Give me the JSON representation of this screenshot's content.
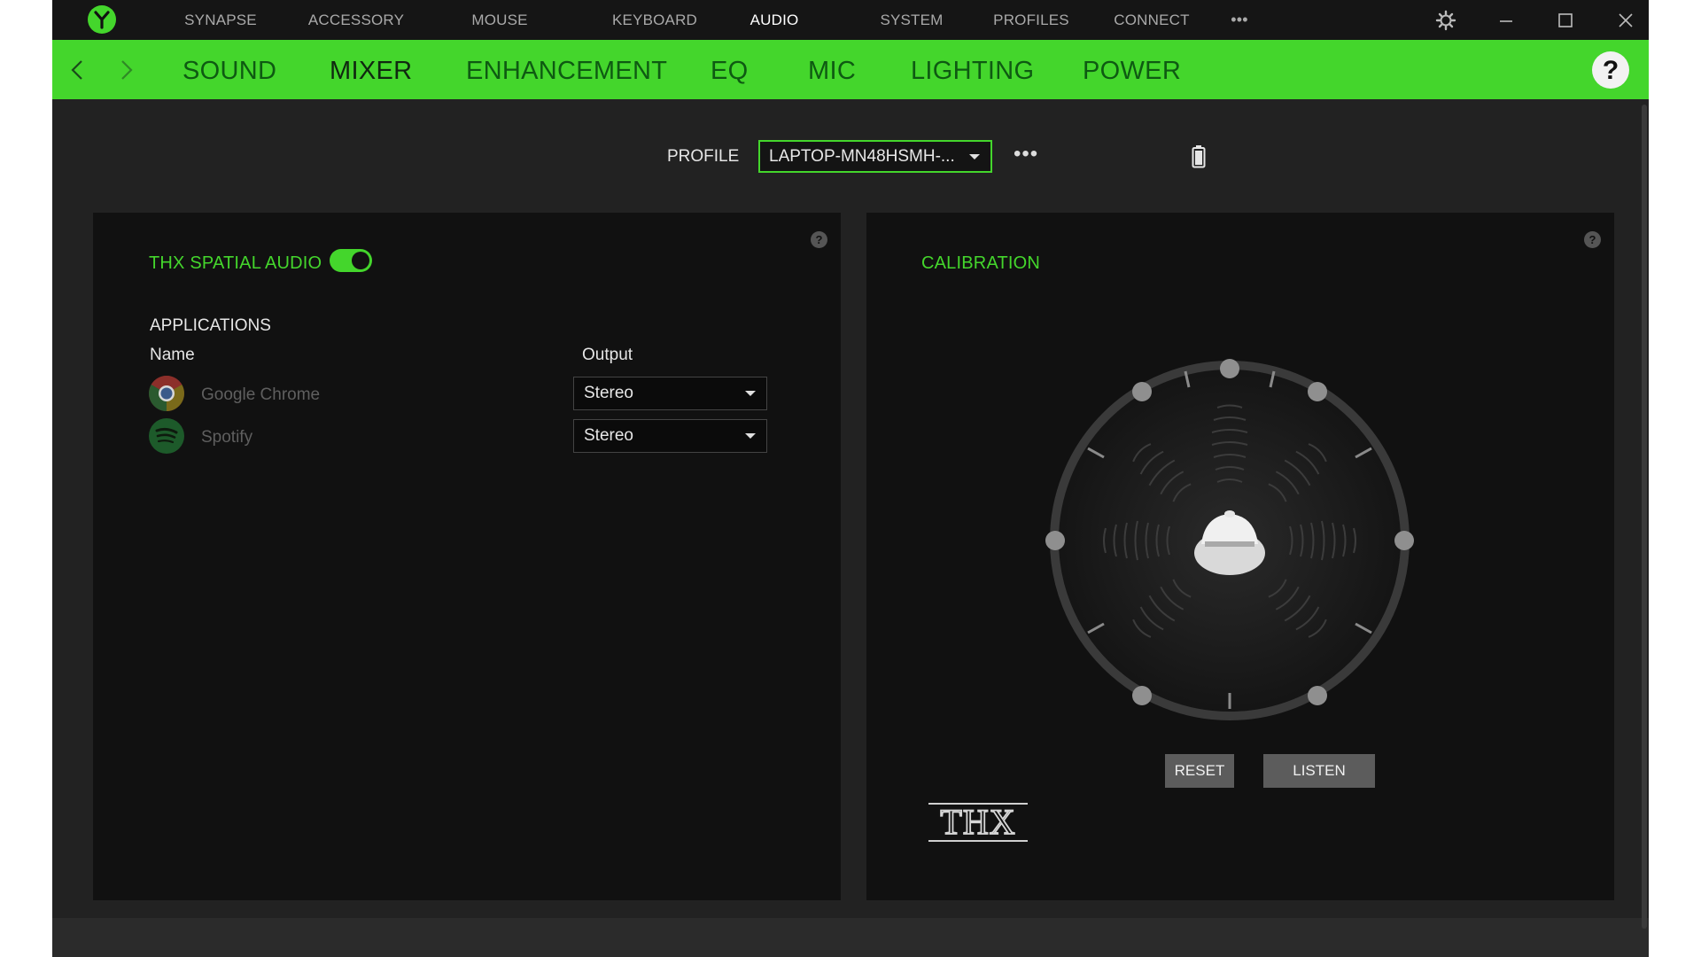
{
  "top_nav": {
    "items": [
      {
        "label": "SYNAPSE"
      },
      {
        "label": "ACCESSORY"
      },
      {
        "label": "MOUSE"
      },
      {
        "label": "KEYBOARD"
      },
      {
        "label": "AUDIO"
      },
      {
        "label": "SYSTEM"
      },
      {
        "label": "PROFILES"
      },
      {
        "label": "CONNECT"
      }
    ],
    "more": "•••",
    "active": "AUDIO"
  },
  "sub_nav": {
    "items": [
      {
        "label": "SOUND"
      },
      {
        "label": "MIXER"
      },
      {
        "label": "ENHANCEMENT"
      },
      {
        "label": "EQ"
      },
      {
        "label": "MIC"
      },
      {
        "label": "LIGHTING"
      },
      {
        "label": "POWER"
      }
    ],
    "active": "MIXER",
    "help": "?"
  },
  "profile": {
    "label": "PROFILE",
    "value": "LAPTOP-MN48HSMH-...",
    "more": "•••"
  },
  "mixer": {
    "thx_label": "THX SPATIAL AUDIO",
    "thx_enabled": true,
    "help": "?",
    "applications_label": "APPLICATIONS",
    "col_name": "Name",
    "col_output": "Output",
    "apps": [
      {
        "name": "Google Chrome",
        "output": "Stereo",
        "icon": "chrome-icon"
      },
      {
        "name": "Spotify",
        "output": "Stereo",
        "icon": "spotify-icon"
      }
    ]
  },
  "calibration": {
    "title": "CALIBRATION",
    "help": "?",
    "reset_label": "RESET",
    "listen_label": "LISTEN",
    "logo_text": "THX"
  },
  "colors": {
    "accent": "#44d62c",
    "background": "#222222",
    "panel": "#111111",
    "topbar": "#151515"
  }
}
